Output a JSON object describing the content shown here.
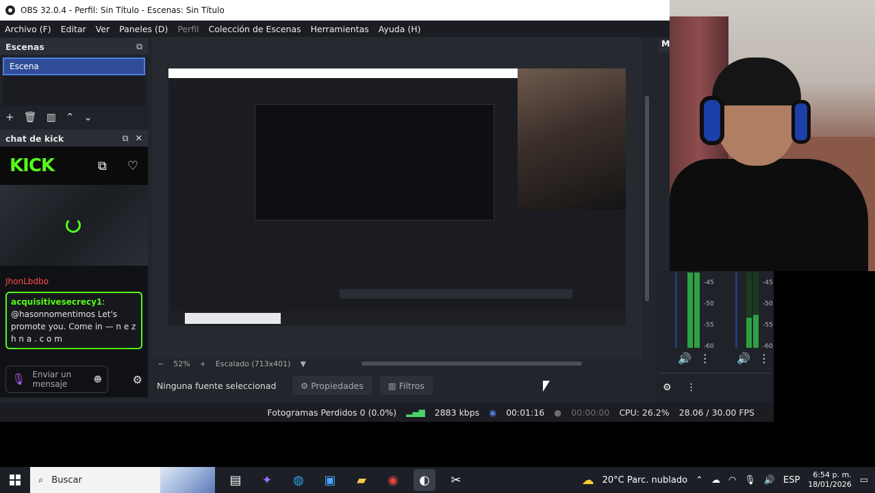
{
  "window": {
    "title": "OBS 32.0.4 - Perfil: Sin Título - Escenas: Sin Título"
  },
  "menu": [
    {
      "label": "Archivo (F)",
      "disabled": false
    },
    {
      "label": "Editar",
      "disabled": false
    },
    {
      "label": "Ver",
      "disabled": false
    },
    {
      "label": "Paneles (D)",
      "disabled": false
    },
    {
      "label": "Perfil",
      "disabled": true
    },
    {
      "label": "Colección de Escenas",
      "disabled": false
    },
    {
      "label": "Herramientas",
      "disabled": false
    },
    {
      "label": "Ayuda (H)",
      "disabled": false
    }
  ],
  "scenes": {
    "title": "Escenas",
    "items": [
      "Escena"
    ],
    "tools": [
      "+",
      "🗑",
      "▥",
      "⌃",
      "⌄"
    ]
  },
  "chat": {
    "title": "chat de kick",
    "logo": "KICK",
    "user1": "JhonLbdbo",
    "message": {
      "user": "acquisitivesecrecy1",
      "text": "@hasonnomentimos Let's promote you. Come in — n e z h n a . c o m"
    },
    "input_placeholder": "Enviar un mensaje"
  },
  "preview": {
    "zoom": "52%",
    "scale": "Escalado (713x401)"
  },
  "source_bar": {
    "label": "Ninguna fuente seleccionad",
    "properties": "Propiedades",
    "filters": "Filtros"
  },
  "mixer": {
    "title_fragment": "M",
    "ticks": [
      "-45",
      "-50",
      "-55",
      "-60"
    ]
  },
  "status": {
    "dropped": "Fotogramas Perdidos 0 (0.0%)",
    "kbps": "2883 kbps",
    "stream_time": "00:01:16",
    "rec_time": "00:00:00",
    "cpu": "CPU: 26.2%",
    "fps": "28.06 / 30.00 FPS"
  },
  "taskbar": {
    "search": "Buscar",
    "weather": "20°C  Parc. nublado",
    "lang": "ESP",
    "time": "6:54 p. m.",
    "date": "18/01/2026"
  },
  "colors": {
    "accent": "#4f7ee8",
    "kick_green": "#53fc18"
  }
}
